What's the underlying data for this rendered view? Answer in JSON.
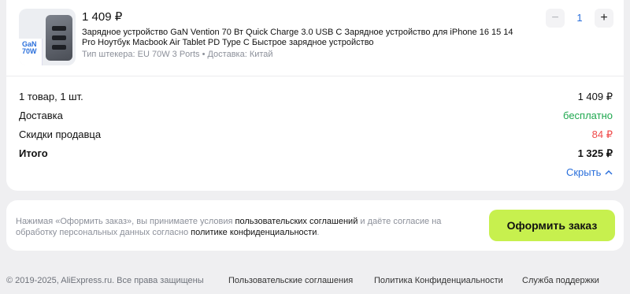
{
  "item": {
    "price": "1 409 ₽",
    "title": "Зарядное устройство GaN Vention 70 Вт Quick Charge 3.0 USB C Зарядное устройство для iPhone 16 15 14 Pro Ноутбук Macbook Air Tablet PD Type C Быстрое зарядное устройство",
    "meta": "Тип штекера: EU 70W 3 Ports • Доставка: Китай",
    "image_text": "GaN 70W",
    "quantity": "1",
    "minus": "−",
    "plus": "+"
  },
  "summary": {
    "rows": [
      {
        "label": "1 товар, 1 шт.",
        "value": "1 409 ₽"
      },
      {
        "label": "Доставка",
        "value": "бесплатно"
      },
      {
        "label": "Скидки продавца",
        "value": "84 ₽"
      },
      {
        "label": "Итого",
        "value": "1 325 ₽"
      }
    ],
    "hide_label": "Скрыть"
  },
  "checkout": {
    "notice_prefix": "Нажимая «Оформить заказ», вы принимаете условия ",
    "terms_link": "пользовательских соглашений",
    "notice_middle": " и даёте согласие на обработку персональных данных согласно ",
    "privacy_link": "политике конфиденциальности",
    "notice_suffix": ".",
    "order_button": "Оформить заказ"
  },
  "footer": {
    "copyright": "© 2019-2025, AliExpress.ru. Все права защищены",
    "links": [
      "Пользовательские соглашения",
      "Политика Конфиденциальности",
      "Служба поддержки"
    ]
  },
  "colors": {
    "accent": "#2a6fdb",
    "button": "#c7f04e",
    "free": "#1fa84f",
    "discount": "#f04a4a"
  }
}
